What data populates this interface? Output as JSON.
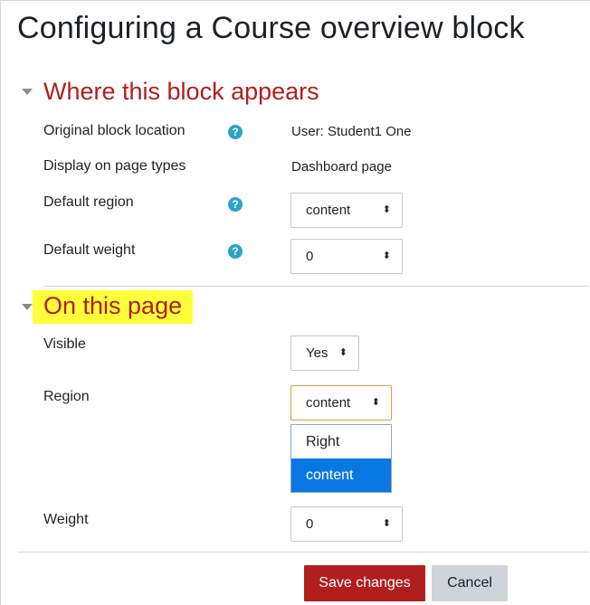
{
  "page": {
    "title": "Configuring a Course overview block"
  },
  "section1": {
    "title": "Where this block appears",
    "original_location": {
      "label": "Original block location",
      "value": "User: Student1 One"
    },
    "page_types": {
      "label": "Display on page types",
      "value": "Dashboard page"
    },
    "default_region": {
      "label": "Default region",
      "value": "content"
    },
    "default_weight": {
      "label": "Default weight",
      "value": "0"
    }
  },
  "section2": {
    "title": "On this page",
    "visible": {
      "label": "Visible",
      "value": "Yes"
    },
    "region": {
      "label": "Region",
      "value": "content",
      "options": [
        "Right",
        "content"
      ]
    },
    "weight": {
      "label": "Weight",
      "value": "0"
    }
  },
  "buttons": {
    "save": "Save changes",
    "cancel": "Cancel"
  },
  "help_icon_glyph": "?",
  "select_arrow_glyph": "⬍",
  "colors": {
    "heading_red": "#b11e1e",
    "highlight": "#ffff3a",
    "help_blue": "#2aa3c7",
    "selected_option": "#0a78e2"
  }
}
